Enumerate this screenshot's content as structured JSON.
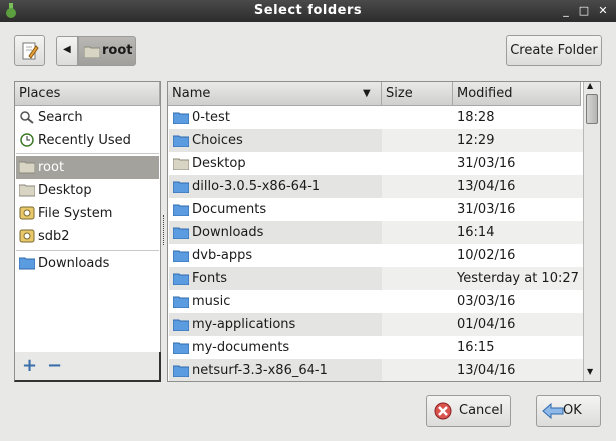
{
  "window": {
    "title": "Select folders",
    "controls": [
      "_",
      "□",
      "✕"
    ]
  },
  "toolbar": {
    "location_label": "root",
    "create_folder_label": "Create Folder"
  },
  "places": {
    "header": "Places",
    "items": [
      {
        "label": "Search",
        "icon": "search-icon"
      },
      {
        "label": "Recently Used",
        "icon": "recent-icon"
      },
      {
        "label": "root",
        "icon": "folder-icon",
        "selected": true
      },
      {
        "label": "Desktop",
        "icon": "folder-icon"
      },
      {
        "label": "File System",
        "icon": "drive-icon"
      },
      {
        "label": "sdb2",
        "icon": "drive-icon"
      },
      {
        "label": "Downloads",
        "icon": "folder-icon"
      }
    ],
    "add_label": "+",
    "remove_label": "−"
  },
  "files": {
    "columns": {
      "name": "Name",
      "size": "Size",
      "modified": "Modified"
    },
    "rows": [
      {
        "name": "0-test",
        "size": "",
        "modified": "18:28",
        "icon": "folder-blue"
      },
      {
        "name": "Choices",
        "size": "",
        "modified": "12:29",
        "icon": "folder-blue"
      },
      {
        "name": "Desktop",
        "size": "",
        "modified": "31/03/16",
        "icon": "folder-plain"
      },
      {
        "name": "dillo-3.0.5-x86-64-1",
        "size": "",
        "modified": "13/04/16",
        "icon": "folder-blue"
      },
      {
        "name": "Documents",
        "size": "",
        "modified": "31/03/16",
        "icon": "folder-blue"
      },
      {
        "name": "Downloads",
        "size": "",
        "modified": "16:14",
        "icon": "folder-blue"
      },
      {
        "name": "dvb-apps",
        "size": "",
        "modified": "10/02/16",
        "icon": "folder-blue"
      },
      {
        "name": "Fonts",
        "size": "",
        "modified": "Yesterday at 10:27",
        "icon": "folder-blue"
      },
      {
        "name": "music",
        "size": "",
        "modified": "03/03/16",
        "icon": "folder-blue"
      },
      {
        "name": "my-applications",
        "size": "",
        "modified": "01/04/16",
        "icon": "folder-blue"
      },
      {
        "name": "my-documents",
        "size": "",
        "modified": "16:15",
        "icon": "folder-blue"
      },
      {
        "name": "netsurf-3.3-x86_64-1",
        "size": "",
        "modified": "13/04/16",
        "icon": "folder-blue"
      }
    ]
  },
  "buttons": {
    "cancel_label": "Cancel",
    "ok_label": "OK"
  },
  "colors": {
    "selection": "#a3a29d",
    "folder_blue": "#4a90d9",
    "titlebar": "#333333"
  }
}
